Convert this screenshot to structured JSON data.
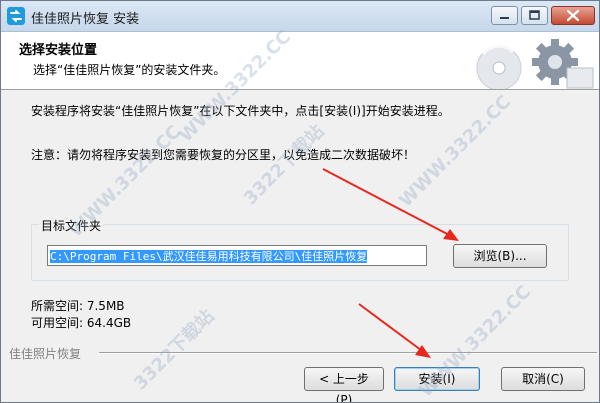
{
  "window": {
    "title": "佳佳照片恢复 安装"
  },
  "header": {
    "title": "选择安装位置",
    "subtitle": "选择“佳佳照片恢复”的安装文件夹。"
  },
  "body": {
    "intro": "安装程序将安装“佳佳照片恢复”在以下文件夹中，点击[安装(I)]开始安装进程。",
    "notice": "注意：请勿将程序安装到您需要恢复的分区里，以免造成二次数据破坏！"
  },
  "destination": {
    "group_label": "目标文件夹",
    "path": "C:\\Program Files\\武汉佳佳易用科技有限公司\\佳佳照片恢复",
    "browse_label": "浏览(B)..."
  },
  "space": {
    "required": "所需空间: 7.5MB",
    "available": "可用空间: 64.4GB"
  },
  "footer": {
    "brand": "佳佳照片恢复",
    "back_label": "< 上一步(P)",
    "install_label": "安装(I)",
    "cancel_label": "取消(C)"
  },
  "watermarks": [
    "WWW.3322.CC",
    "WWW.3322.CC",
    "3322下载站",
    "WWW.3322.CC",
    "3322下载站",
    "WWW.3322.CC"
  ],
  "colors": {
    "selection": "#3399ff",
    "arrow": "#e8281e",
    "close_button": "#c44a33"
  }
}
